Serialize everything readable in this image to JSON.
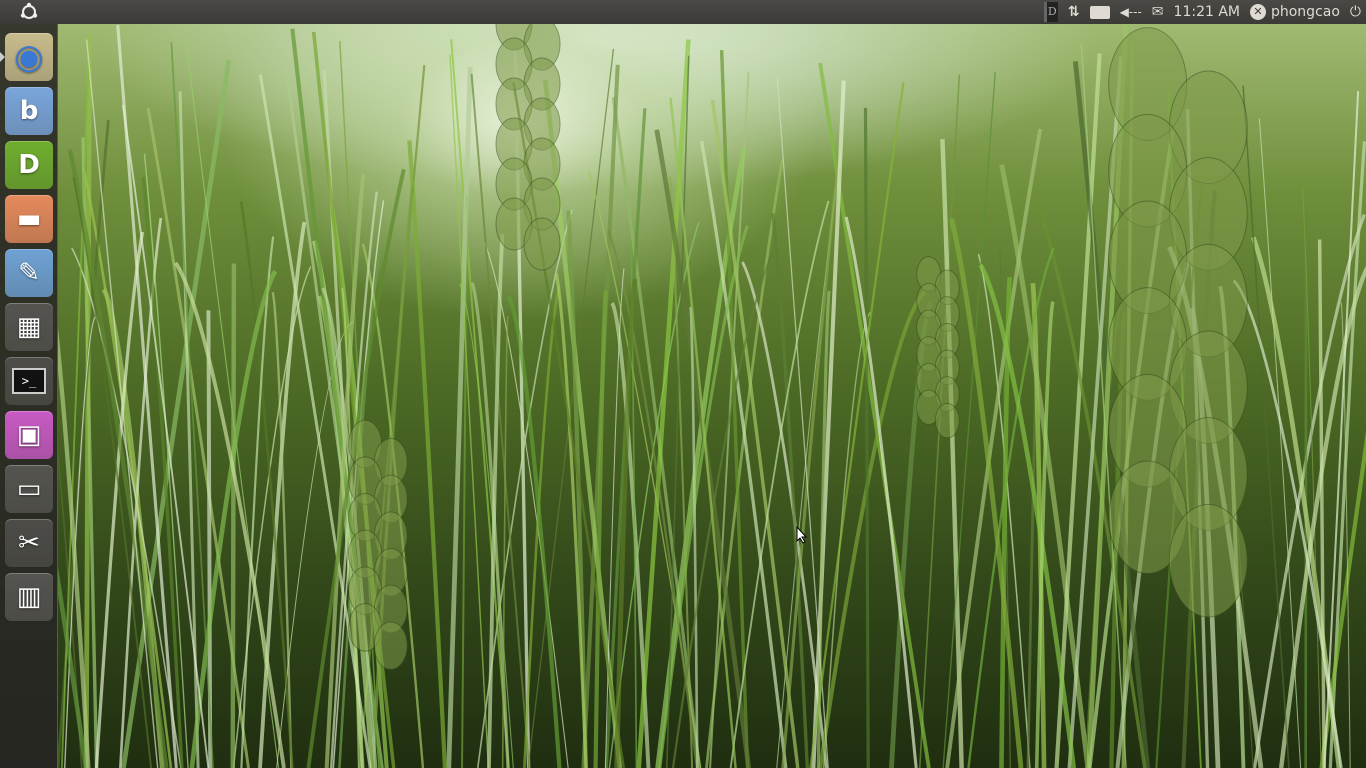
{
  "panel": {
    "clock": "11:21 AM",
    "username": "phongcao",
    "indicators": [
      "dictionary-indicator-icon",
      "network-icon",
      "keyboard-icon",
      "volume-muted-icon",
      "mail-icon",
      "user-status-icon",
      "power-icon"
    ]
  },
  "launcher": {
    "items": [
      {
        "name": "chrome",
        "icon": "chrome-icon",
        "color": "#c8bc8c",
        "running": true
      },
      {
        "name": "bluefish",
        "icon": "bluefish-icon",
        "color": "#7aa6dc"
      },
      {
        "name": "dictionary",
        "icon": "dictionary-icon",
        "color": "#6fae2e"
      },
      {
        "name": "file-manager-app",
        "icon": "folder-cursor-icon",
        "color": "#e58a5c"
      },
      {
        "name": "text-editor",
        "icon": "document-edit-icon",
        "color": "#6fa2d4"
      },
      {
        "name": "calculator",
        "icon": "calculator-icon",
        "color": "#555450"
      },
      {
        "name": "terminal",
        "icon": "terminal-icon",
        "color": "#4d4c48"
      },
      {
        "name": "workspace-switcher",
        "icon": "workspaces-icon",
        "color": "#c95bc5"
      },
      {
        "name": "files",
        "icon": "folder-icon",
        "color": "#555450"
      },
      {
        "name": "appearance",
        "icon": "scissors-ruler-icon",
        "color": "#4d4c48"
      },
      {
        "name": "trash",
        "icon": "trash-icon",
        "color": "#555450"
      }
    ]
  }
}
